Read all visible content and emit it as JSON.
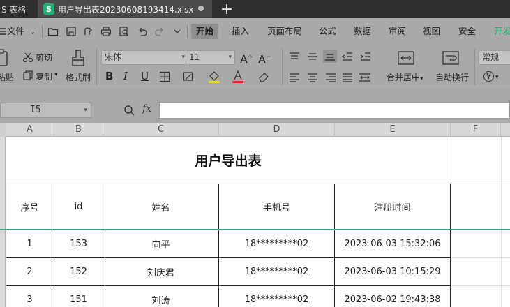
{
  "tabs": {
    "inactive_label": "S 表格",
    "active_label": "用户导出表20230608193414.xlsx",
    "new_tab_symbol": "+",
    "app_logo_letter": "S"
  },
  "menu": {
    "file_label": "文件",
    "items": [
      "开始",
      "插入",
      "页面布局",
      "公式",
      "数据",
      "审阅",
      "视图",
      "安全",
      "开发"
    ],
    "active_item": "开始"
  },
  "ribbon": {
    "paste_label": "粘贴",
    "cut_label": "剪切",
    "copy_label": "复制",
    "format_painter_label": "格式刷",
    "font_name": "宋体",
    "font_size": "11",
    "bold": "B",
    "italic": "I",
    "underline": "U",
    "merge_center_label": "合并居中",
    "wrap_text_label": "自动换行",
    "number_format": "常规",
    "currency_symbol": "¥",
    "font_color_bar": "#e0262e",
    "fill_color_bar": "#f3d71a"
  },
  "formula_bar": {
    "cell_ref": "I5",
    "fx_label": "fx",
    "formula": ""
  },
  "columns": [
    "A",
    "B",
    "C",
    "D",
    "E",
    "F"
  ],
  "sheet": {
    "title": "用户导出表",
    "headers": [
      "序号",
      "id",
      "姓名",
      "手机号",
      "注册时间"
    ],
    "rows": [
      [
        "1",
        "153",
        "向平",
        "18*********02",
        "2023-06-03 15:32:06"
      ],
      [
        "2",
        "152",
        "刘庆君",
        "18*********02",
        "2023-06-03 10:15:29"
      ],
      [
        "3",
        "151",
        "刘涛",
        "18*********02",
        "2023-06-02 19:43:38"
      ]
    ]
  },
  "colors": {
    "accent_green": "#1fb076",
    "freeze_line": "#3aa57a"
  }
}
